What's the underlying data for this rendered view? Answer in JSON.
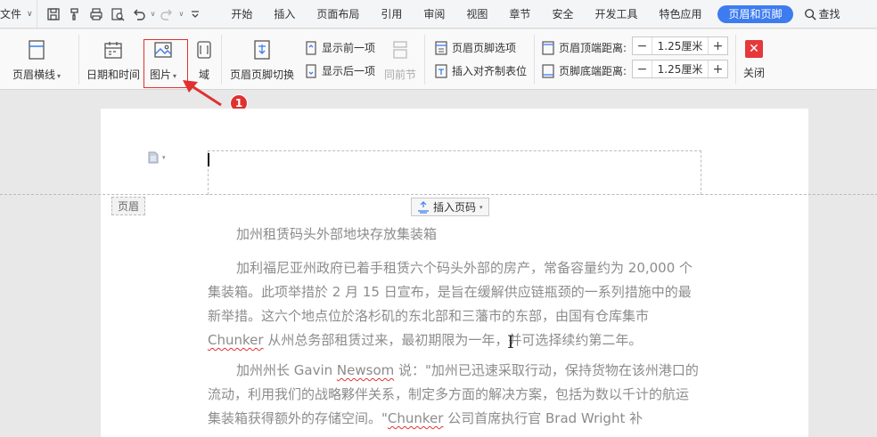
{
  "menubar": {
    "file_label": "文件",
    "tabs": [
      "开始",
      "插入",
      "页面布局",
      "引用",
      "审阅",
      "视图",
      "章节",
      "安全",
      "开发工具",
      "特色应用"
    ],
    "active_tab": "页眉和页脚",
    "search_label": "查找"
  },
  "ribbon": {
    "header_line": "页眉横线",
    "date_time": "日期和时间",
    "picture": "图片",
    "field": "域",
    "switch": "页眉页脚切换",
    "show_prev": "显示前一项",
    "show_next": "显示后一项",
    "same_as_prev": "同前节",
    "options": "页眉页脚选项",
    "insert_align_tab": "插入对齐制表位",
    "header_top_label": "页眉顶端距离:",
    "header_top_value": "1.25厘米",
    "footer_bottom_label": "页脚底端距离:",
    "footer_bottom_value": "1.25厘米",
    "close": "关闭"
  },
  "callout": {
    "number": "1"
  },
  "document": {
    "header_tag": "页眉",
    "insert_page_number": "插入页码",
    "title": "加州租赁码头外部地块存放集装箱",
    "p1_a": "加利福尼亚州政府已着手租赁六个码头外部的房产，常备容量约为 20,000 个集装箱。此项举措於 2 月 15 日宣布，是旨在缓解供应链瓶颈的一系列措施中的最新举措。这六个地点位於洛杉矶的东北部和三藩市的东部，由国有仓库集市 ",
    "p1_word": "Chunker",
    "p1_b": " 从州总务部租赁过来，最初期限为一年，并可选择续约第二年。",
    "p2_a": "加州州长 Gavin ",
    "p2_word": "Newsom",
    "p2_b": " 说：\"加州已迅速采取行动，保持货物在该州港口的流动，利用我们的战略夥伴关系，制定多方面的解决方案，包括为数以千计的航运集装箱获得额外的存储空间。\"",
    "p2_word2": "Chunker",
    "p2_c": " 公司首席执行官 Brad Wright 补"
  }
}
